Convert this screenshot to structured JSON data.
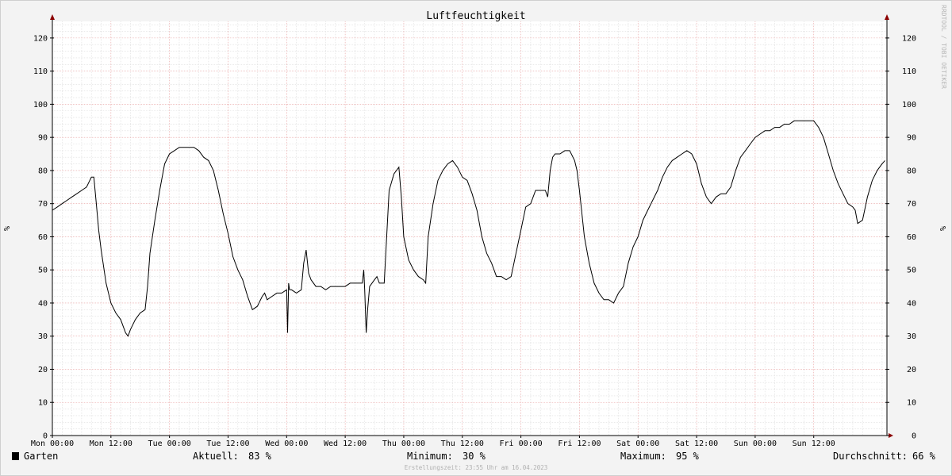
{
  "chart_data": {
    "type": "line",
    "title": "Luftfeuchtigkeit",
    "ylabel": "%",
    "ylabel_right": "%",
    "ylim": [
      0,
      125
    ],
    "yticks": [
      0,
      10,
      20,
      30,
      40,
      50,
      60,
      70,
      80,
      90,
      100,
      110,
      120
    ],
    "xlim": [
      0,
      168
    ],
    "x_unit": "hours since Mon 00:00",
    "xticks": [
      {
        "x": 0,
        "label": "Mon 00:00"
      },
      {
        "x": 12,
        "label": "Mon 12:00"
      },
      {
        "x": 24,
        "label": "Tue 00:00"
      },
      {
        "x": 36,
        "label": "Tue 12:00"
      },
      {
        "x": 48,
        "label": "Wed 00:00"
      },
      {
        "x": 60,
        "label": "Wed 12:00"
      },
      {
        "x": 72,
        "label": "Thu 00:00"
      },
      {
        "x": 84,
        "label": "Thu 12:00"
      },
      {
        "x": 96,
        "label": "Fri 00:00"
      },
      {
        "x": 108,
        "label": "Fri 12:00"
      },
      {
        "x": 120,
        "label": "Sat 00:00"
      },
      {
        "x": 132,
        "label": "Sat 12:00"
      },
      {
        "x": 144,
        "label": "Sun 00:00"
      },
      {
        "x": 156,
        "label": "Sun 12:00"
      }
    ],
    "grid": true,
    "series": [
      {
        "name": "Garten",
        "color": "#000000",
        "points": [
          [
            0,
            68
          ],
          [
            1,
            69
          ],
          [
            2,
            70
          ],
          [
            3,
            71
          ],
          [
            4,
            72
          ],
          [
            5,
            73
          ],
          [
            6,
            74
          ],
          [
            7,
            75
          ],
          [
            8,
            78
          ],
          [
            8.5,
            78
          ],
          [
            9,
            70
          ],
          [
            9.5,
            62
          ],
          [
            10,
            56
          ],
          [
            11,
            46
          ],
          [
            12,
            40
          ],
          [
            13,
            37
          ],
          [
            14,
            35
          ],
          [
            15,
            31
          ],
          [
            15.5,
            30
          ],
          [
            16,
            32
          ],
          [
            17,
            35
          ],
          [
            18,
            37
          ],
          [
            19,
            38
          ],
          [
            19.5,
            45
          ],
          [
            20,
            55
          ],
          [
            21,
            65
          ],
          [
            22,
            74
          ],
          [
            23,
            82
          ],
          [
            24,
            85
          ],
          [
            25,
            86
          ],
          [
            26,
            87
          ],
          [
            27,
            87
          ],
          [
            28,
            87
          ],
          [
            29,
            87
          ],
          [
            30,
            86
          ],
          [
            31,
            84
          ],
          [
            32,
            83
          ],
          [
            33,
            80
          ],
          [
            34,
            74
          ],
          [
            35,
            67
          ],
          [
            36,
            61
          ],
          [
            37,
            54
          ],
          [
            38,
            50
          ],
          [
            39,
            47
          ],
          [
            40,
            42
          ],
          [
            41,
            38
          ],
          [
            42,
            39
          ],
          [
            43,
            42
          ],
          [
            43.5,
            43
          ],
          [
            44,
            41
          ],
          [
            45,
            42
          ],
          [
            46,
            43
          ],
          [
            47,
            43
          ],
          [
            48,
            44
          ],
          [
            48.2,
            31
          ],
          [
            48.4,
            46
          ],
          [
            48.6,
            44
          ],
          [
            49,
            44
          ],
          [
            50,
            43
          ],
          [
            51,
            44
          ],
          [
            51.5,
            52
          ],
          [
            52,
            56
          ],
          [
            52.5,
            49
          ],
          [
            53,
            47
          ],
          [
            54,
            45
          ],
          [
            55,
            45
          ],
          [
            56,
            44
          ],
          [
            57,
            45
          ],
          [
            58,
            45
          ],
          [
            59,
            45
          ],
          [
            60,
            45
          ],
          [
            61,
            46
          ],
          [
            62,
            46
          ],
          [
            63,
            46
          ],
          [
            63.5,
            46
          ],
          [
            63.8,
            50
          ],
          [
            64,
            44
          ],
          [
            64.3,
            31
          ],
          [
            64.6,
            38
          ],
          [
            65,
            45
          ],
          [
            66,
            47
          ],
          [
            66.5,
            48
          ],
          [
            67,
            46
          ],
          [
            68,
            46
          ],
          [
            68.5,
            60
          ],
          [
            69,
            74
          ],
          [
            70,
            79
          ],
          [
            71,
            81
          ],
          [
            71.5,
            72
          ],
          [
            72,
            60
          ],
          [
            73,
            53
          ],
          [
            74,
            50
          ],
          [
            75,
            48
          ],
          [
            76,
            47
          ],
          [
            76.5,
            46
          ],
          [
            77,
            60
          ],
          [
            78,
            70
          ],
          [
            79,
            77
          ],
          [
            80,
            80
          ],
          [
            81,
            82
          ],
          [
            82,
            83
          ],
          [
            83,
            81
          ],
          [
            84,
            78
          ],
          [
            85,
            77
          ],
          [
            86,
            73
          ],
          [
            87,
            68
          ],
          [
            88,
            60
          ],
          [
            89,
            55
          ],
          [
            90,
            52
          ],
          [
            91,
            48
          ],
          [
            92,
            48
          ],
          [
            93,
            47
          ],
          [
            94,
            48
          ],
          [
            95,
            55
          ],
          [
            96,
            62
          ],
          [
            97,
            69
          ],
          [
            98,
            70
          ],
          [
            99,
            74
          ],
          [
            100,
            74
          ],
          [
            101,
            74
          ],
          [
            101.5,
            72
          ],
          [
            102,
            80
          ],
          [
            102.5,
            84
          ],
          [
            103,
            85
          ],
          [
            104,
            85
          ],
          [
            105,
            86
          ],
          [
            106,
            86
          ],
          [
            107,
            83
          ],
          [
            107.5,
            80
          ],
          [
            108,
            74
          ],
          [
            109,
            60
          ],
          [
            110,
            52
          ],
          [
            111,
            46
          ],
          [
            112,
            43
          ],
          [
            113,
            41
          ],
          [
            114,
            41
          ],
          [
            115,
            40
          ],
          [
            116,
            43
          ],
          [
            117,
            45
          ],
          [
            118,
            52
          ],
          [
            119,
            57
          ],
          [
            120,
            60
          ],
          [
            121,
            65
          ],
          [
            122,
            68
          ],
          [
            123,
            71
          ],
          [
            124,
            74
          ],
          [
            125,
            78
          ],
          [
            126,
            81
          ],
          [
            127,
            83
          ],
          [
            128,
            84
          ],
          [
            129,
            85
          ],
          [
            130,
            86
          ],
          [
            131,
            85
          ],
          [
            132,
            82
          ],
          [
            133,
            76
          ],
          [
            134,
            72
          ],
          [
            135,
            70
          ],
          [
            136,
            72
          ],
          [
            137,
            73
          ],
          [
            138,
            73
          ],
          [
            139,
            75
          ],
          [
            140,
            80
          ],
          [
            141,
            84
          ],
          [
            142,
            86
          ],
          [
            143,
            88
          ],
          [
            144,
            90
          ],
          [
            145,
            91
          ],
          [
            146,
            92
          ],
          [
            147,
            92
          ],
          [
            148,
            93
          ],
          [
            149,
            93
          ],
          [
            150,
            94
          ],
          [
            151,
            94
          ],
          [
            152,
            95
          ],
          [
            153,
            95
          ],
          [
            154,
            95
          ],
          [
            155,
            95
          ],
          [
            156,
            95
          ],
          [
            157,
            93
          ],
          [
            158,
            90
          ],
          [
            159,
            85
          ],
          [
            160,
            80
          ],
          [
            161,
            76
          ],
          [
            162,
            73
          ],
          [
            163,
            70
          ],
          [
            164,
            69
          ],
          [
            164.5,
            68
          ],
          [
            165,
            64
          ],
          [
            166,
            65
          ],
          [
            167,
            72
          ],
          [
            168,
            77
          ],
          [
            169,
            80
          ],
          [
            170,
            82
          ],
          [
            170.6,
            83
          ]
        ]
      }
    ]
  },
  "legend": {
    "series_name": "Garten",
    "aktuell_label": "Aktuell:",
    "aktuell_value": "83 %",
    "minimum_label": "Minimum:",
    "minimum_value": "30 %",
    "maximum_label": "Maximum:",
    "maximum_value": "95 %",
    "durchschnitt_label": "Durchschnitt:",
    "durchschnitt_value": "66 %"
  },
  "footer": {
    "text": "Erstellungszeit: 23:55 Uhr am 16.04.2023"
  },
  "watermark": {
    "text": "RRDTOOL / TOBI OETIKER"
  },
  "colors": {
    "canvas": "#ffffff",
    "frame": "#f3f3f3",
    "minor_grid": "#dddddd",
    "major_grid": "#e8a0a0",
    "axis_arrow": "#8b0000",
    "series": "#000000"
  }
}
